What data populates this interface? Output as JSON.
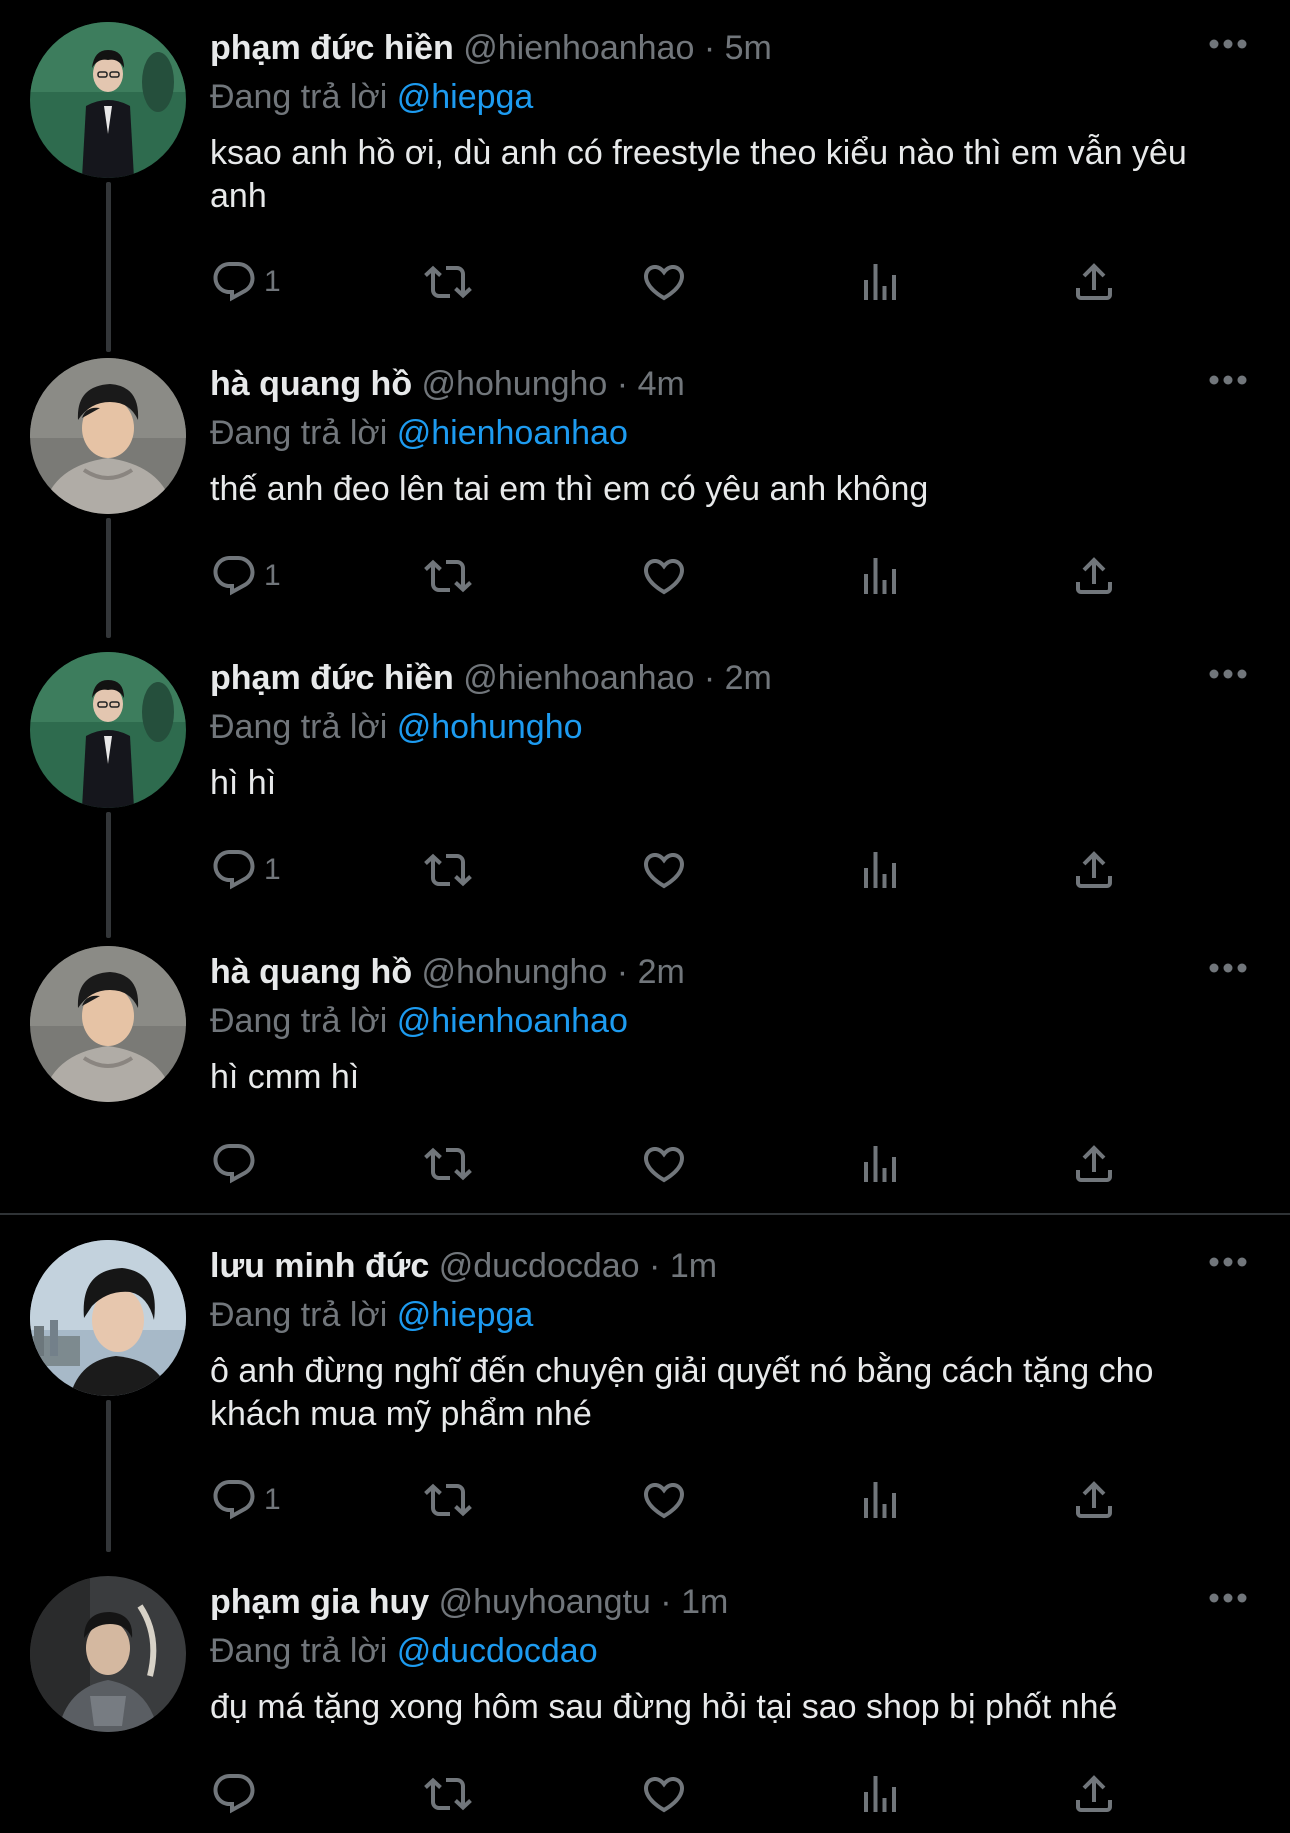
{
  "replying_prefix": "Đang trả lời",
  "colors": {
    "background": "#000000",
    "text": "#e7e9ea",
    "secondary": "#71767b",
    "mention": "#1d9bf0"
  },
  "tweets": [
    {
      "name": "phạm đức hiền",
      "handle": "@hienhoanhao",
      "dot": "·",
      "time": "5m",
      "replying_to": "@hiepga",
      "text": "ksao anh hồ ơi, dù anh có freestyle theo kiểu nào thì em vẫn yêu anh",
      "reply_count": "1",
      "avatar": "avatar-green-suit"
    },
    {
      "name": "hà quang hồ",
      "handle": "@hohungho",
      "dot": "·",
      "time": "4m",
      "replying_to": "@hienhoanhao",
      "text": "thế anh đeo lên tai em thì em có yêu anh không",
      "reply_count": "1",
      "avatar": "avatar-grey-hoodie"
    },
    {
      "name": "phạm đức hiền",
      "handle": "@hienhoanhao",
      "dot": "·",
      "time": "2m",
      "replying_to": "@hohungho",
      "text": "hì hì",
      "reply_count": "1",
      "avatar": "avatar-green-suit"
    },
    {
      "name": "hà quang hồ",
      "handle": "@hohungho",
      "dot": "·",
      "time": "2m",
      "replying_to": "@hienhoanhao",
      "text": "hì cmm hì",
      "reply_count": "",
      "avatar": "avatar-grey-hoodie"
    },
    {
      "name": "lưu minh đức",
      "handle": "@ducdocdao",
      "dot": "·",
      "time": "1m",
      "replying_to": "@hiepga",
      "text": "ô anh đừng nghĩ đến chuyện giải quyết nó bằng cách tặng cho khách mua mỹ phẩm nhé",
      "reply_count": "1",
      "avatar": "avatar-sky-portrait"
    },
    {
      "name": "phạm gia huy",
      "handle": "@huyhoangtu",
      "dot": "·",
      "time": "1m",
      "replying_to": "@ducdocdao",
      "text": "đụ má tặng xong hôm sau đừng hỏi tại sao shop bị phốt nhé",
      "reply_count": "",
      "avatar": "avatar-dark-jersey"
    }
  ]
}
